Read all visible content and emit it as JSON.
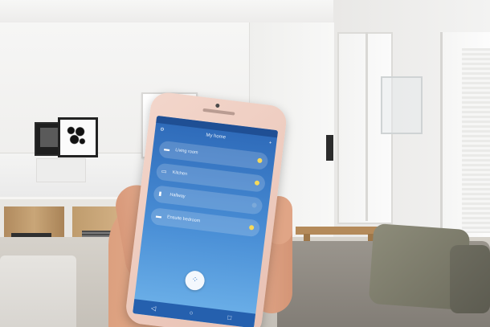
{
  "phone": {
    "status_time": "",
    "header_title": "My home",
    "rooms": [
      {
        "label": "Living room",
        "icon": "sofa-icon",
        "bulb_color": "#f6d95a"
      },
      {
        "label": "Kitchen",
        "icon": "kitchen-icon",
        "bulb_color": "#f6d95a"
      },
      {
        "label": "Hallway",
        "icon": "door-icon",
        "bulb_color": "#7ba9d9"
      },
      {
        "label": "Ensuite bedroom",
        "icon": "bed-icon",
        "bulb_color": "#f6d95a"
      }
    ],
    "fab_icon": "grid-icon",
    "nav": [
      "back-icon",
      "home-icon",
      "recents-icon"
    ]
  },
  "colors": {
    "screen_top": "#2d69b8",
    "screen_bottom": "#6fb3ea",
    "phone_body": "#f3d6cb"
  }
}
